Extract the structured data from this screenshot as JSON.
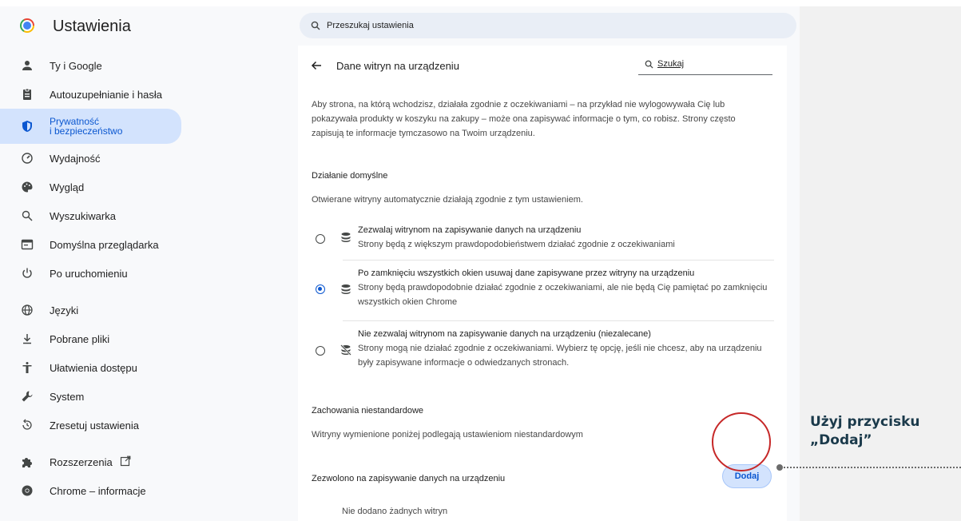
{
  "app": {
    "title": "Ustawienia"
  },
  "search": {
    "placeholder": "Przeszukaj ustawienia"
  },
  "sidebar": {
    "items": [
      {
        "label": "Ty i Google",
        "icon": "person-icon"
      },
      {
        "label": "Autouzupełnianie i hasła",
        "icon": "clipboard-icon"
      },
      {
        "label": "Prywatność i bezpieczeństwo",
        "label_line1": "Prywatność",
        "label_line2": "i bezpieczeństwo",
        "icon": "shield-icon",
        "active": true
      },
      {
        "label": "Wydajność",
        "icon": "speedometer-icon"
      },
      {
        "label": "Wygląd",
        "icon": "palette-icon"
      },
      {
        "label": "Wyszukiwarka",
        "icon": "search-icon"
      },
      {
        "label": "Domyślna przeglądarka",
        "icon": "browser-icon"
      },
      {
        "label": "Po uruchomieniu",
        "icon": "power-icon"
      },
      {
        "label": "Języki",
        "icon": "globe-icon"
      },
      {
        "label": "Pobrane pliki",
        "icon": "download-icon"
      },
      {
        "label": "Ułatwienia dostępu",
        "icon": "accessibility-icon"
      },
      {
        "label": "System",
        "icon": "wrench-icon"
      },
      {
        "label": "Zresetuj ustawienia",
        "icon": "reset-icon"
      },
      {
        "label": "Rozszerzenia",
        "icon": "puzzle-icon"
      },
      {
        "label": "Chrome – informacje",
        "icon": "chrome-icon"
      }
    ]
  },
  "content": {
    "title": "Dane witryn na urządzeniu",
    "search_placeholder": "Szukaj",
    "description": "Aby strona, na którą wchodzisz, działała zgodnie z oczekiwaniami – na przykład nie wylogowywała Cię lub pokazywała produkty w koszyku na zakupy – może ona zapisywać informacje o tym, co robisz. Strony często zapisują te informacje tymczasowo na Twoim urządzeniu.",
    "default_heading": "Działanie domyślne",
    "default_sub": "Otwierane witryny automatycznie działają zgodnie z tym ustawieniem.",
    "options": [
      {
        "line1": "Zezwalaj witrynom na zapisywanie danych na urządzeniu",
        "line2": "Strony będą z większym prawdopodobieństwem działać zgodnie z oczekiwaniami",
        "checked": false,
        "icon": "database-icon"
      },
      {
        "line1": "Po zamknięciu wszystkich okien usuwaj dane zapisywane przez witryny na urządzeniu",
        "line2": "Strony będą prawdopodobnie działać zgodnie z oczekiwaniami, ale nie będą Cię pamiętać po zamknięciu wszystkich okien Chrome",
        "checked": true,
        "icon": "database-icon"
      },
      {
        "line1": "Nie zezwalaj witrynom na zapisywanie danych na urządzeniu (niezalecane)",
        "line2": "Strony mogą nie działać zgodnie z oczekiwaniami. Wybierz tę opcję, jeśli nie chcesz, aby na urządzeniu były zapisywane informacje o odwiedzanych stronach.",
        "checked": false,
        "icon": "database-off-icon"
      }
    ],
    "custom_heading": "Zachowania niestandardowe",
    "custom_sub": "Witryny wymienione poniżej podlegają ustawieniom niestandardowym",
    "allowed_label": "Zezwolono na zapisywanie danych na urządzeniu",
    "add_label": "Dodaj",
    "empty_label": "Nie dodano żadnych witryn"
  },
  "annotation": {
    "text": "Użyj przycisku „Dodaj”",
    "color": "#c62828"
  },
  "colors": {
    "accent": "#0b57d0",
    "active_bg": "#d3e3fd",
    "callout_text": "#1b3a4b"
  }
}
